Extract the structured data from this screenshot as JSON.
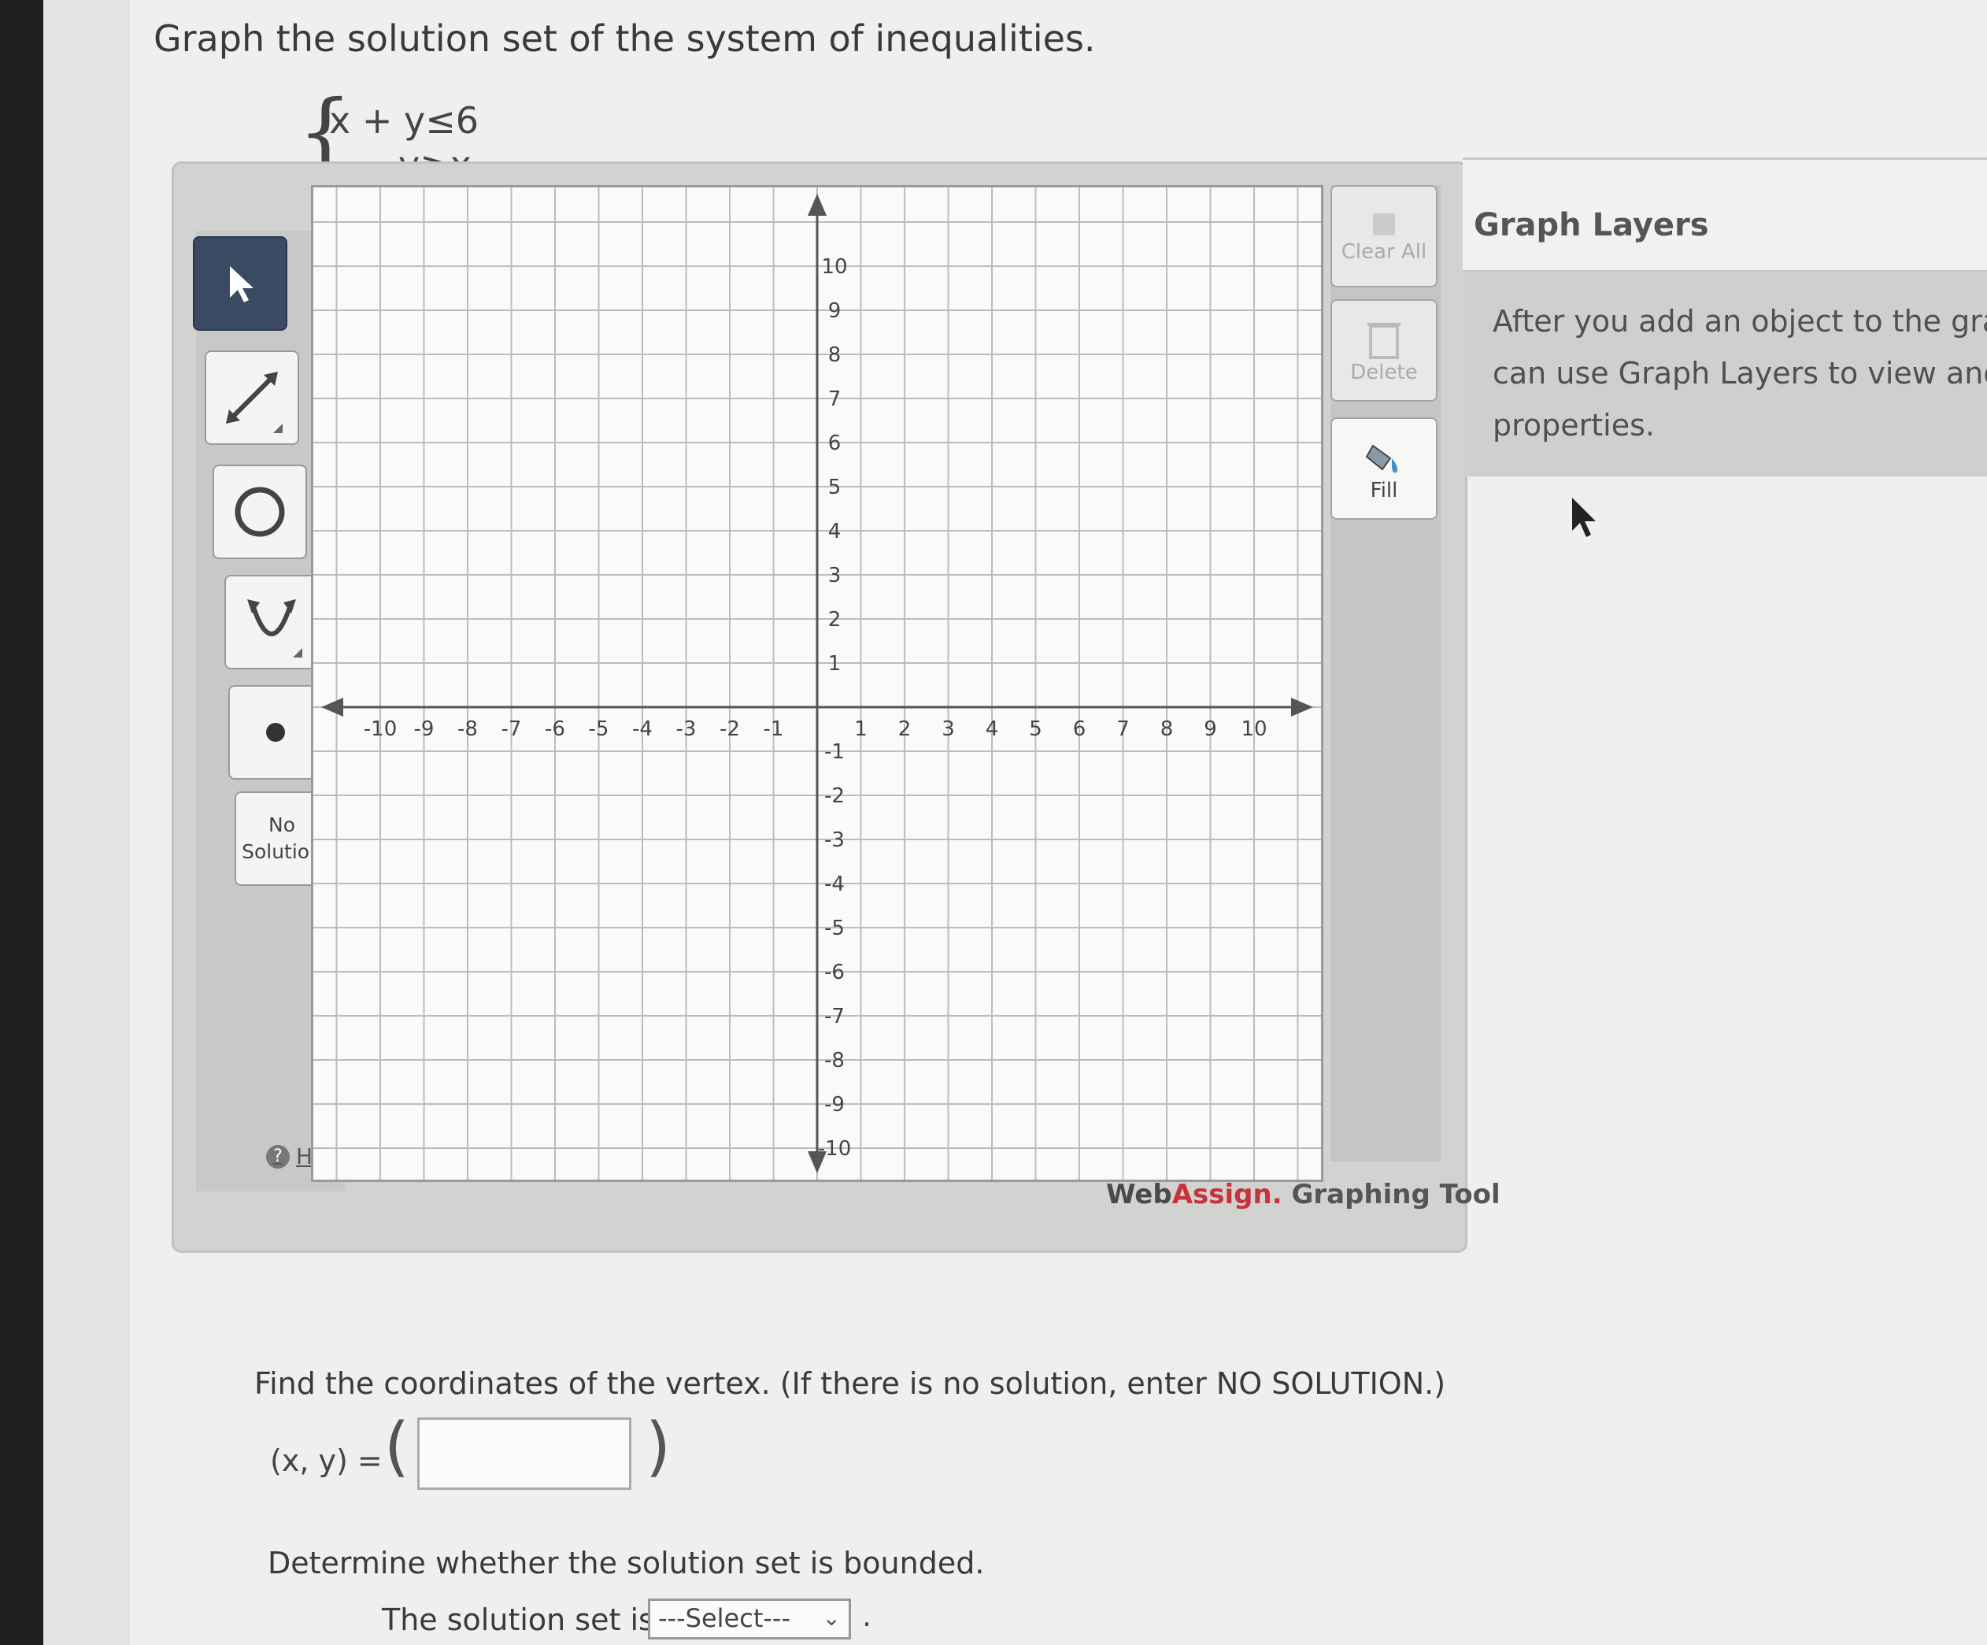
{
  "prompt": "Graph the solution set of the system of inequalities.",
  "system": {
    "line1": "x + y≤6",
    "line2": "y≥x"
  },
  "toolbar": {
    "tools": [
      "pointer-icon",
      "line-tool-icon",
      "circle-tool-icon",
      "parabola-tool-icon",
      "point-tool-icon"
    ],
    "no_solution": "No Solution",
    "help": "Help"
  },
  "right_tools": {
    "clear_all": "Clear All",
    "delete": "Delete",
    "fill": "Fill"
  },
  "brand": {
    "web": "Web",
    "assign": "Assign.",
    "rest": " Graphing Tool"
  },
  "layers": {
    "title": "Graph Layers",
    "body": [
      "After you add an object to the graph",
      "can use Graph Layers to view and e",
      "properties."
    ]
  },
  "graph": {
    "x_ticks": [
      "-10",
      "-9",
      "-8",
      "-7",
      "-6",
      "-5",
      "-4",
      "-3",
      "-2",
      "-1",
      "1",
      "2",
      "3",
      "4",
      "5",
      "6",
      "7",
      "8",
      "9",
      "10"
    ],
    "y_ticks": [
      "10",
      "9",
      "8",
      "7",
      "6",
      "5",
      "4",
      "3",
      "2",
      "1",
      "-1",
      "-2",
      "-3",
      "-4",
      "-5",
      "-6",
      "-7",
      "-8",
      "-9",
      "-10"
    ],
    "range": [
      -10,
      10
    ]
  },
  "vertex_question": "Find the coordinates of the vertex. (If there is no solution, enter NO SOLUTION.)",
  "xy_label": "(x, y) =",
  "vertex_value": "",
  "bounded_question": "Determine whether the solution set is bounded.",
  "solution_set_label": "The solution set is",
  "select_value": "---Select---",
  "period": "."
}
